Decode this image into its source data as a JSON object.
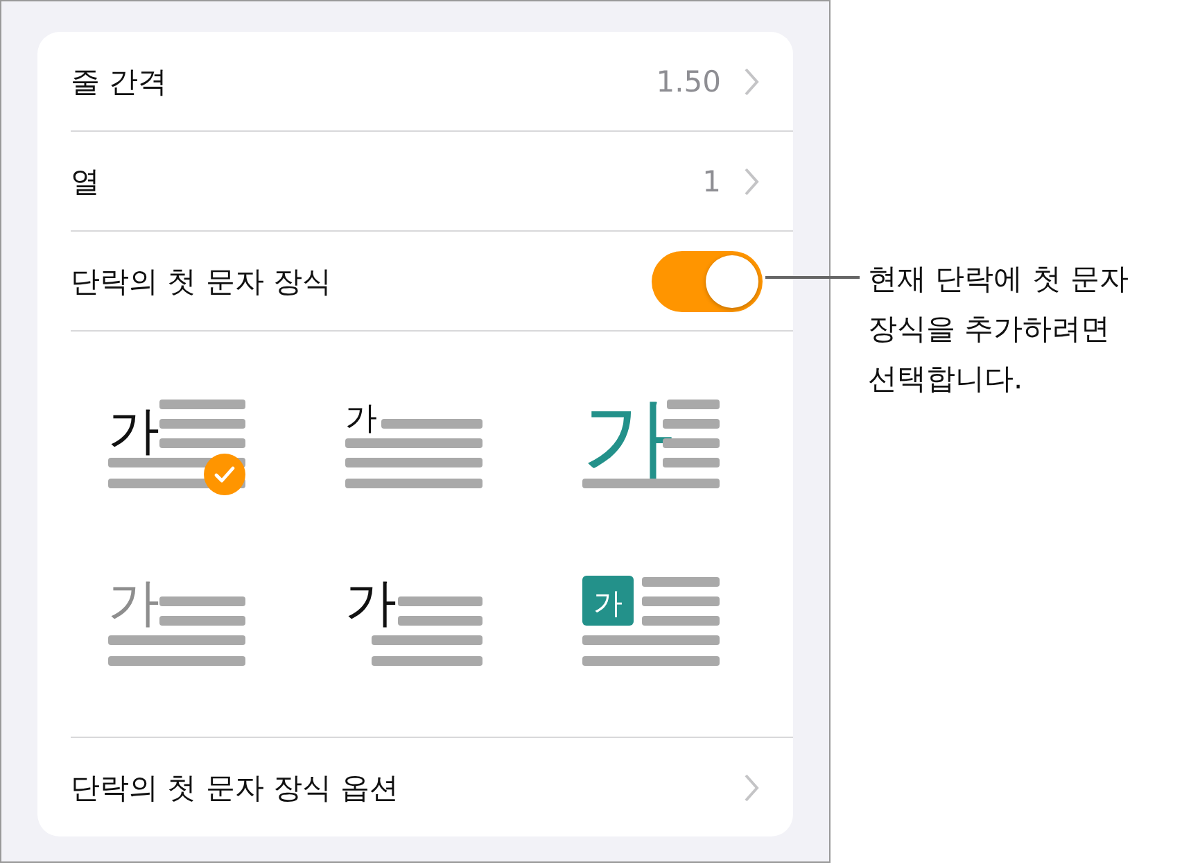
{
  "rows": [
    {
      "kind": "value",
      "label": "줄 간격",
      "value": "1.50"
    },
    {
      "kind": "value",
      "label": "열",
      "value": "1"
    },
    {
      "kind": "toggle",
      "label": "단락의 첫 문자 장식",
      "on": true
    }
  ],
  "styles": [
    {
      "kind": "drop",
      "glyph": "가",
      "selected": true
    },
    {
      "kind": "raised",
      "glyph": "가",
      "selected": false
    },
    {
      "kind": "large",
      "glyph": "가",
      "selected": false
    },
    {
      "kind": "light",
      "glyph": "가",
      "selected": false
    },
    {
      "kind": "hanging",
      "glyph": "가",
      "selected": false
    },
    {
      "kind": "boxed",
      "glyph": "가",
      "selected": false
    }
  ],
  "options_row": {
    "label": "단락의 첫 문자 장식 옵션"
  },
  "callout": "현재 단락에 첫 문자 장식을 추가하려면 선택합니다."
}
